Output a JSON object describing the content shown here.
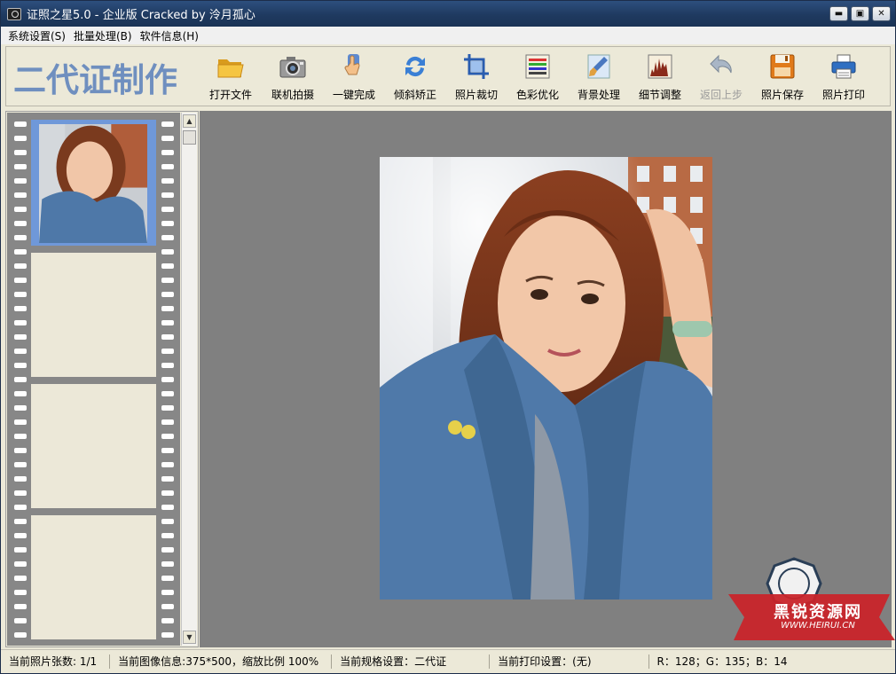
{
  "window": {
    "title": "证照之星5.0 - 企业版 Cracked by 泠月孤心",
    "controls": {
      "minimize": "▬",
      "restore": "▣",
      "close": "✕"
    }
  },
  "menu": [
    {
      "label": "系统设置(S)"
    },
    {
      "label": "批量处理(B)"
    },
    {
      "label": "软件信息(H)"
    }
  ],
  "toolbar": {
    "brand": "二代证制作",
    "tools": [
      {
        "label": "打开文件",
        "icon": "folder-open-icon"
      },
      {
        "label": "联机拍摄",
        "icon": "camera-icon"
      },
      {
        "label": "一键完成",
        "icon": "hand-click-icon"
      },
      {
        "label": "倾斜矫正",
        "icon": "rotate-arrows-icon"
      },
      {
        "label": "照片裁切",
        "icon": "crop-icon"
      },
      {
        "label": "色彩优化",
        "icon": "color-bars-icon"
      },
      {
        "label": "背景处理",
        "icon": "paint-brush-icon"
      },
      {
        "label": "细节调整",
        "icon": "histogram-icon"
      },
      {
        "label": "返回上步",
        "icon": "undo-arrow-icon",
        "disabled": true
      },
      {
        "label": "照片保存",
        "icon": "floppy-disk-icon"
      },
      {
        "label": "照片打印",
        "icon": "printer-icon"
      }
    ]
  },
  "filmstrip": {
    "frames": [
      {
        "state": "selected-thumbnail"
      },
      {
        "state": "empty"
      },
      {
        "state": "empty"
      },
      {
        "state": "empty"
      }
    ]
  },
  "colors": {
    "title_bar": "#1f3a60",
    "brand_text": "#6f8fbf",
    "canvas": "#808080",
    "film": "#878787",
    "frame_selected": "#6f98d9",
    "frame_empty": "#ece8d8",
    "watermark_red": "#c8242a"
  },
  "watermark": {
    "brand": "黑锐资源网",
    "domain": "WWW.HEIRUI.CN"
  },
  "status": {
    "photo_count": "当前照片张数: 1/1",
    "image_info": "当前图像信息:375*500，缩放比例 100%",
    "spec": "当前规格设置：二代证",
    "print": "当前打印设置：(无)",
    "rgb": "R：128；G：135；B：14"
  }
}
